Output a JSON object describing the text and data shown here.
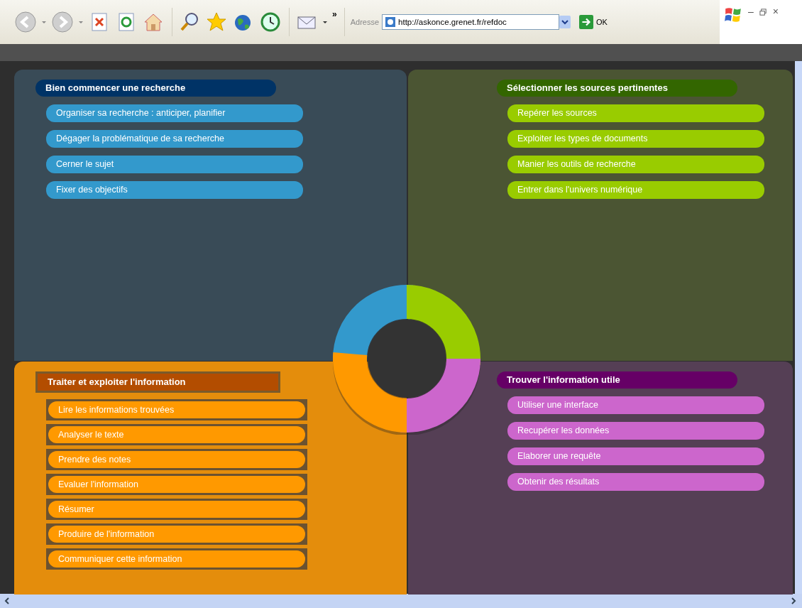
{
  "toolbar": {
    "more": "»",
    "address_label": "Adresse",
    "address": "http://askonce.grenet.fr/refdoc",
    "go": "OK"
  },
  "window_controls": {
    "minimize": "–",
    "close": "×"
  },
  "quadrants": [
    {
      "title": "Bien commencer une recherche",
      "color": "#3399cc",
      "items": [
        "Organiser sa recherche : anticiper, planifier",
        "Dégager la problématique de sa recherche",
        "Cerner le sujet",
        "Fixer des objectifs"
      ]
    },
    {
      "title": "Sélectionner les sources pertinentes",
      "color": "#99cc00",
      "items": [
        "Repérer les sources",
        "Exploiter les types de documents",
        "Manier les outils de recherche",
        "Entrer dans l'univers numérique"
      ]
    },
    {
      "title": "Traiter et exploiter l'information",
      "color": "#ff9900",
      "items": [
        "Lire les informations trouvées",
        "Analyser le texte",
        "Prendre des notes",
        "Evaluer l'information",
        "Résumer",
        "Produire de l'information",
        "Communiquer cette information"
      ]
    },
    {
      "title": "Trouver l'information utile",
      "color": "#cc66cc",
      "items": [
        "Utiliser une interface",
        "Recupérer les données",
        "Elaborer une requête",
        "Obtenir des résultats"
      ]
    }
  ]
}
